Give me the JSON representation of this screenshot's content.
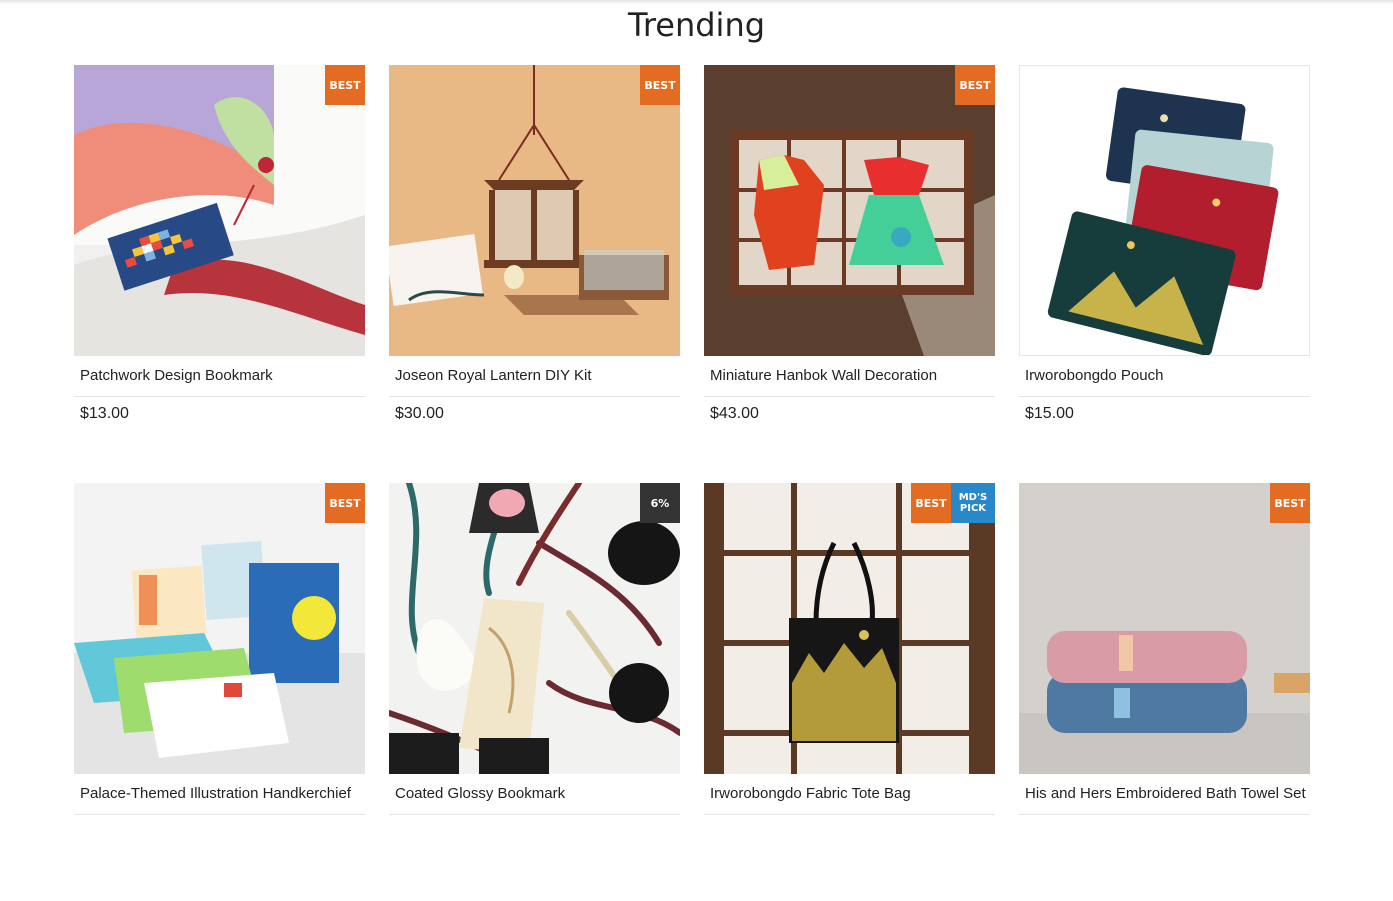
{
  "section": {
    "title": "Trending"
  },
  "colors": {
    "best": "#e46b22",
    "discount": "#333333",
    "mdpick": "#2a87c8"
  },
  "products": [
    {
      "name": "Patchwork Design Bookmark",
      "price": "$13.00",
      "badges": [
        {
          "text": "BEST",
          "type": "best"
        }
      ],
      "image": "bookmark-on-book"
    },
    {
      "name": "Joseon Royal Lantern DIY Kit",
      "price": "$30.00",
      "badges": [
        {
          "text": "BEST",
          "type": "best"
        }
      ],
      "image": "wooden-lantern-kit"
    },
    {
      "name": "Miniature Hanbok Wall Decoration",
      "price": "$43.00",
      "badges": [
        {
          "text": "BEST",
          "type": "best"
        }
      ],
      "image": "hanbok-frame"
    },
    {
      "name": "Irworobongdo Pouch",
      "price": "$15.00",
      "badges": [],
      "image": "stacked-pouches"
    },
    {
      "name": "Palace-Themed Illustration Handkerchief",
      "price": "",
      "badges": [
        {
          "text": "BEST",
          "type": "best"
        }
      ],
      "image": "handkerchiefs"
    },
    {
      "name": "Coated Glossy Bookmark",
      "price": "",
      "badges": [
        {
          "text": "6%",
          "type": "discount"
        }
      ],
      "image": "glossy-bookmarks"
    },
    {
      "name": "Irworobongdo Fabric Tote Bag",
      "price": "",
      "badges": [
        {
          "text": "BEST",
          "type": "best"
        },
        {
          "text": "MD'S PICK",
          "type": "mdpick"
        }
      ],
      "image": "tote-bag-on-door"
    },
    {
      "name": "His and Hers Embroidered Bath Towel Set",
      "price": "",
      "badges": [
        {
          "text": "BEST",
          "type": "best"
        }
      ],
      "image": "folded-towels"
    }
  ]
}
